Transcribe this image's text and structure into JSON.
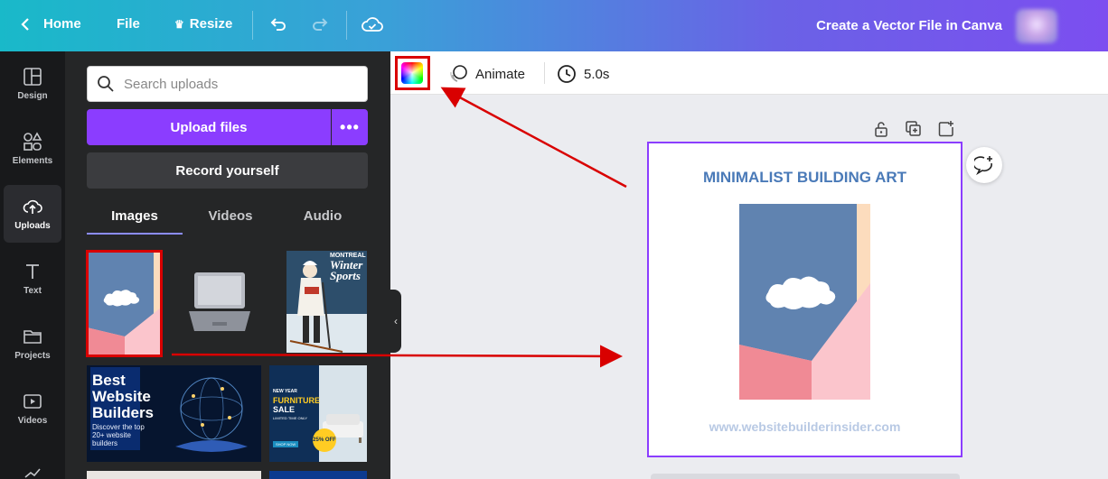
{
  "topbar": {
    "home_label": "Home",
    "file_label": "File",
    "resize_label": "Resize",
    "doc_title": "Create a Vector File in Canva"
  },
  "rail": {
    "items": [
      {
        "label": "Design",
        "icon": "design-icon"
      },
      {
        "label": "Elements",
        "icon": "elements-icon"
      },
      {
        "label": "Uploads",
        "icon": "upload-cloud-icon"
      },
      {
        "label": "Text",
        "icon": "text-icon"
      },
      {
        "label": "Projects",
        "icon": "folder-icon"
      },
      {
        "label": "Videos",
        "icon": "video-icon"
      }
    ]
  },
  "panel": {
    "search_placeholder": "Search uploads",
    "upload_label": "Upload files",
    "more_label": "•••",
    "record_label": "Record yourself",
    "tabs": [
      "Images",
      "Videos",
      "Audio"
    ],
    "thumbs": {
      "sports_title": "MONTREAL",
      "sports_line1": "Winter",
      "sports_line2": "Sports",
      "builders_line1": "Best",
      "builders_line2": "Website",
      "builders_line3": "Builders",
      "builders_sub": "Discover the top 20+ website builders",
      "furniture_top": "NEW YEAR",
      "furniture_main": "FURNITURE",
      "furniture_sale": "SALE",
      "furniture_limited": "LIMITED TIME ONLY",
      "furniture_shop": "SHOP NOW",
      "furniture_badge": "25% OFF"
    }
  },
  "toolbar": {
    "animate_label": "Animate",
    "duration_label": "5.0s"
  },
  "canvas": {
    "title": "MINIMALIST BUILDING ART",
    "url": "www.websitebuilderinsider.com"
  },
  "colors": {
    "accent": "#8b3dff",
    "highlight": "#d90000",
    "sky": "#6083b0",
    "pink_light": "#fbc5cc",
    "pink_dark": "#f08a95",
    "peach": "#fcdcbd"
  }
}
